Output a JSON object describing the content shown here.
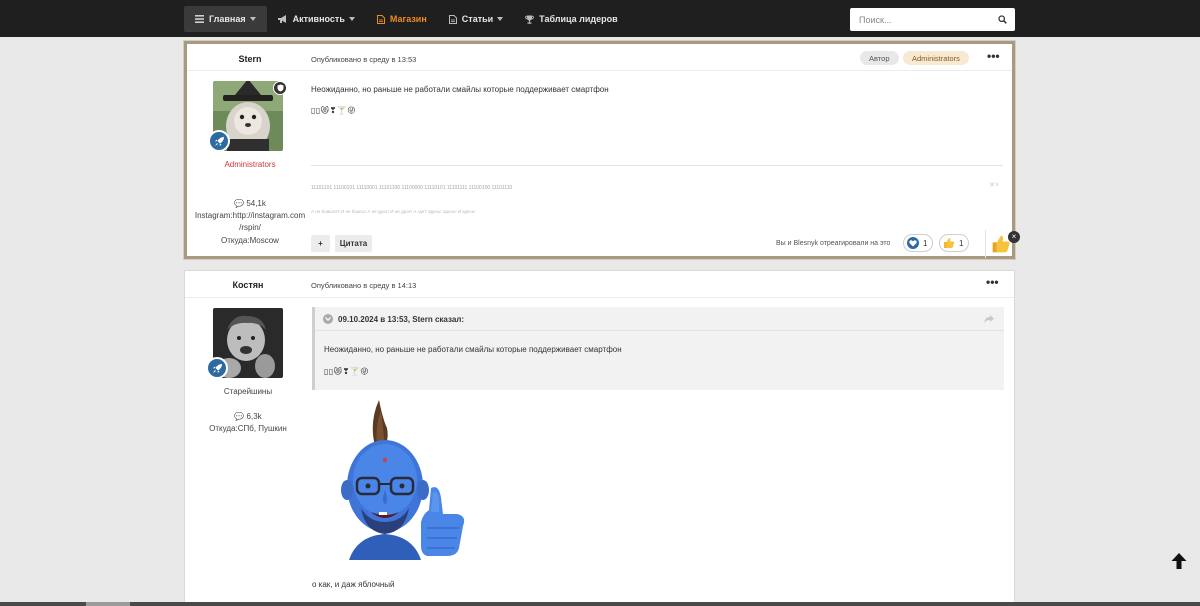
{
  "nav": {
    "items": [
      {
        "label": "Главная",
        "icon": "list-icon",
        "active": true,
        "caret": true
      },
      {
        "label": "Активность",
        "icon": "megaphone-icon",
        "active": false,
        "caret": true
      },
      {
        "label": "Магазин",
        "icon": "document-icon",
        "active": false,
        "caret": false,
        "accent": "#ef8a1e"
      },
      {
        "label": "Статьи",
        "icon": "document-icon",
        "active": false,
        "caret": true
      },
      {
        "label": "Таблица лидеров",
        "icon": "trophy-icon",
        "active": false,
        "caret": false
      }
    ],
    "search_placeholder": "Поиск..."
  },
  "post1": {
    "author": "Stern",
    "date": "Опубликовано в среду в 13:53",
    "badges": [
      "Автор",
      "Administrators"
    ],
    "group": "Administrators",
    "posts_count": "54,1k",
    "instagram_line1": "Instagram:http://instagram.com",
    "instagram_line2": "/rspin/",
    "location": "Откуда:Moscow",
    "text": "Неожиданно, но раньше не работали смайлы которые поддерживает смартфон",
    "emojis": "▯▯😻❣🍸😜",
    "signature_binary": "11101101 11100101 11110001 11101100 11100000 11110101 11101111 11100100 11101110",
    "signature_small": "А не боишся? И не боюсь! А не дрос! И не дрос! А где? Здесь! Здесь! И здесь!",
    "add_label": "+",
    "quote_label": "Цитата",
    "reacted_text": "Вы и Blesnyk отреагировали на это",
    "reactions": [
      {
        "icon": "heart-reaction-icon",
        "count": "1"
      },
      {
        "icon": "thumbs-up-reaction-icon",
        "count": "1"
      }
    ],
    "close_glyph": "×"
  },
  "post2": {
    "author": "Костян",
    "date": "Опубликовано в среду в 14:13",
    "group": "Старейшины",
    "posts_count": "6,3k",
    "location": "Откуда:СПб, Пушкин",
    "quote_cite": "09.10.2024 в 13:53, Stern сказал:",
    "quote_text": "Неожиданно, но раньше не работали смайлы которые поддерживает смартфон",
    "quote_emojis": "▯▯😻❣🍸😜",
    "reply_text": "о как, и даж яблочный"
  },
  "colors": {
    "accent_orange": "#ef8a1e",
    "admin_red": "#cc3a3a",
    "rank_blue": "#2d6aa3",
    "highlight_border": "#a89982"
  }
}
